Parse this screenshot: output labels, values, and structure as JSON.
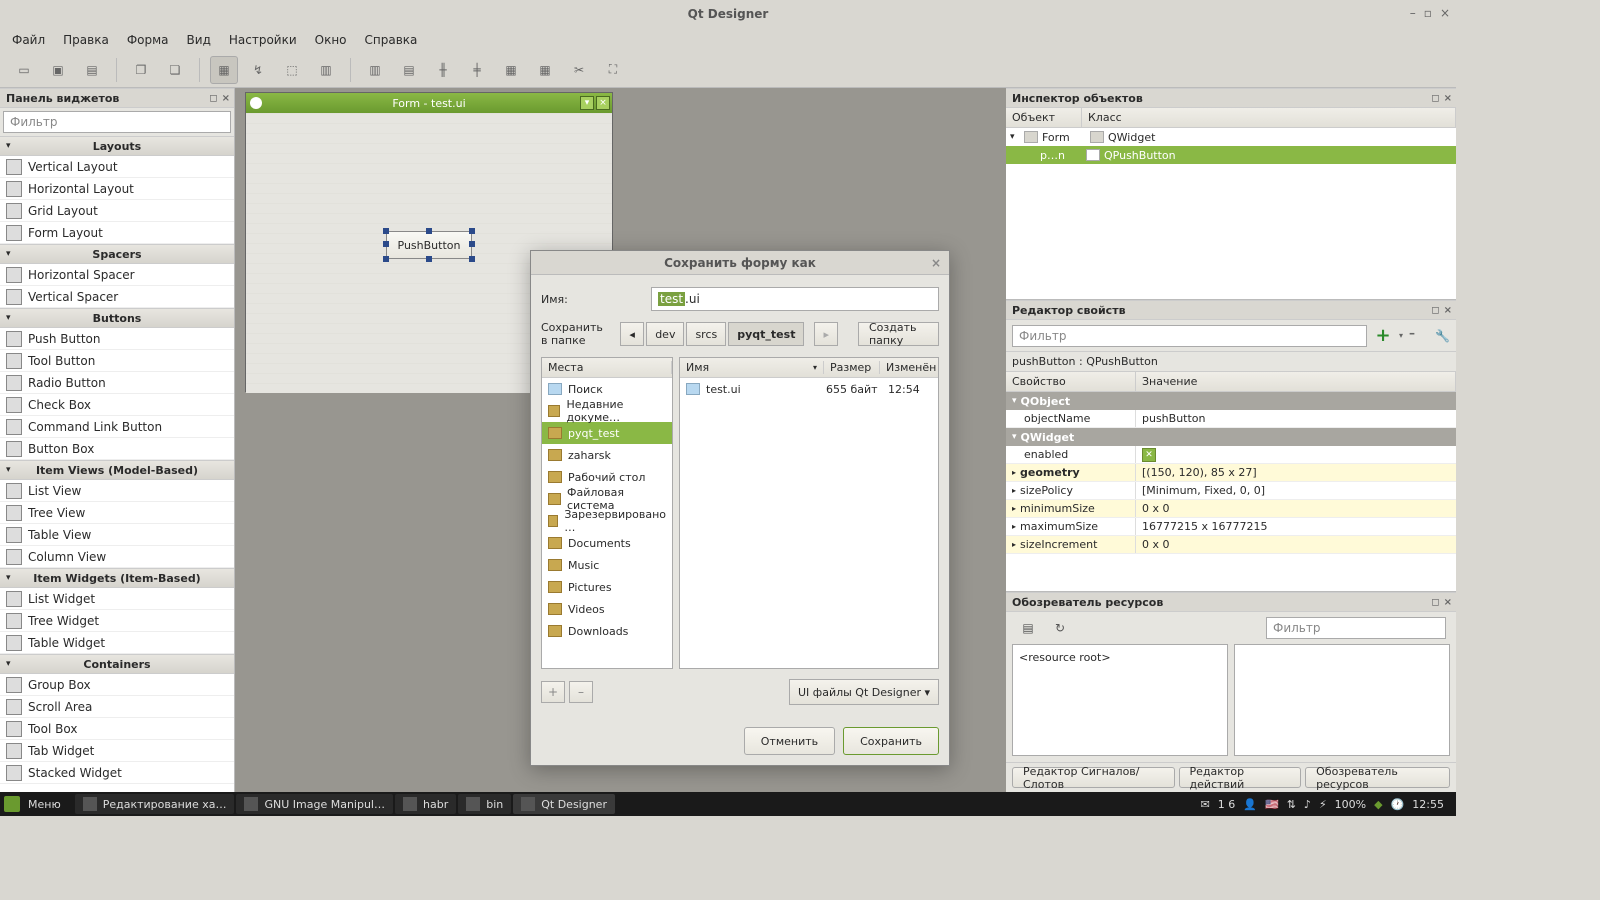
{
  "window": {
    "title": "Qt Designer"
  },
  "menubar": [
    "Файл",
    "Правка",
    "Форма",
    "Вид",
    "Настройки",
    "Окно",
    "Справка"
  ],
  "widgetbox": {
    "title": "Панель виджетов",
    "filter_placeholder": "Фильтр",
    "categories": [
      {
        "name": "Layouts",
        "items": [
          "Vertical Layout",
          "Horizontal Layout",
          "Grid Layout",
          "Form Layout"
        ]
      },
      {
        "name": "Spacers",
        "items": [
          "Horizontal Spacer",
          "Vertical Spacer"
        ]
      },
      {
        "name": "Buttons",
        "items": [
          "Push Button",
          "Tool Button",
          "Radio Button",
          "Check Box",
          "Command Link Button",
          "Button Box"
        ]
      },
      {
        "name": "Item Views (Model-Based)",
        "items": [
          "List View",
          "Tree View",
          "Table View",
          "Column View"
        ]
      },
      {
        "name": "Item Widgets (Item-Based)",
        "items": [
          "List Widget",
          "Tree Widget",
          "Table Widget"
        ]
      },
      {
        "name": "Containers",
        "items": [
          "Group Box",
          "Scroll Area",
          "Tool Box",
          "Tab Widget",
          "Stacked Widget"
        ]
      }
    ]
  },
  "form": {
    "title": "Form - test.ui",
    "button_label": "PushButton"
  },
  "dialog": {
    "title": "Сохранить форму как",
    "name_label": "Имя:",
    "name_value_sel": "test",
    "name_value_rest": ".ui",
    "folder_label": "Сохранить в папке",
    "path": [
      "dev",
      "srcs",
      "pyqt_test"
    ],
    "create_folder": "Создать папку",
    "places_header": "Места",
    "places": [
      "Поиск",
      "Недавние докуме…",
      "pyqt_test",
      "zaharsk",
      "Рабочий стол",
      "Файловая система",
      "Зарезервировано …",
      "Documents",
      "Music",
      "Pictures",
      "Videos",
      "Downloads"
    ],
    "places_selected": 2,
    "file_headers": {
      "name": "Имя",
      "size": "Размер",
      "modified": "Изменён"
    },
    "files": [
      {
        "name": "test.ui",
        "size": "655 байт",
        "modified": "12:54"
      }
    ],
    "filetype": "UI файлы Qt Designer",
    "cancel": "Отменить",
    "save": "Сохранить"
  },
  "inspector": {
    "title": "Инспектор объектов",
    "headers": {
      "object": "Объект",
      "class": "Класс"
    },
    "root": {
      "name": "Form",
      "cls": "QWidget"
    },
    "child": {
      "name": "p…n",
      "cls": "QPushButton"
    }
  },
  "propeditor": {
    "title": "Редактор свойств",
    "filter_placeholder": "Фильтр",
    "object_label": "pushButton : QPushButton",
    "headers": {
      "prop": "Свойство",
      "val": "Значение"
    },
    "groups": [
      {
        "name": "QObject",
        "rows": [
          {
            "name": "objectName",
            "val": "pushButton"
          }
        ]
      },
      {
        "name": "QWidget",
        "rows": [
          {
            "name": "enabled",
            "val": "check"
          },
          {
            "name": "geometry",
            "val": "[(150, 120), 85 x 27]",
            "bold": true,
            "hl": true,
            "expand": true
          },
          {
            "name": "sizePolicy",
            "val": "[Minimum, Fixed, 0, 0]",
            "expand": true
          },
          {
            "name": "minimumSize",
            "val": "0 x 0",
            "hl": true,
            "expand": true
          },
          {
            "name": "maximumSize",
            "val": "16777215 x 16777215",
            "expand": true
          },
          {
            "name": "sizeIncrement",
            "val": "0 x 0",
            "hl": true,
            "expand": true
          }
        ]
      }
    ]
  },
  "resources": {
    "title": "Обозреватель ресурсов",
    "filter_placeholder": "Фильтр",
    "root": "<resource root>",
    "tabs": [
      "Редактор Сигналов/Слотов",
      "Редактор действий",
      "Обозреватель ресурсов"
    ]
  },
  "taskbar": {
    "menu": "Меню",
    "items": [
      {
        "label": "Редактирование ха…"
      },
      {
        "label": "GNU Image Manipul…"
      },
      {
        "label": "habr"
      },
      {
        "label": "bin"
      },
      {
        "label": "Qt Designer",
        "active": true
      }
    ],
    "tray": {
      "mail": "1 6",
      "battery": "100%",
      "time": "12:55"
    }
  }
}
